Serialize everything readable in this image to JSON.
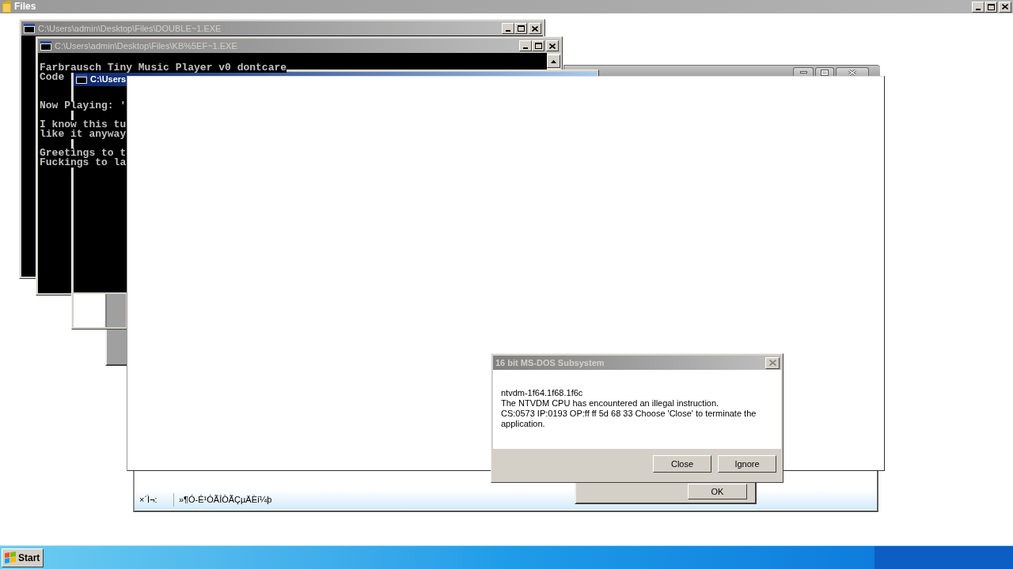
{
  "top_window": {
    "title": "Files"
  },
  "console_windows": [
    {
      "title": "C:\\Users\\admin\\Desktop\\Files\\DOUBLE~1.EXE",
      "active": false
    },
    {
      "title": "C:\\Users\\admin\\Desktop\\Files\\KB%5EF~1.EXE",
      "active": false,
      "output": [
        [
          "Farbrausch Tiny Music Player v0 dontcare",
          "Code"
        ],
        [
          "Now Playing: '"
        ],
        [
          "I know this tu",
          "like it anyway"
        ],
        [
          "Greetings to t",
          "Fuckings to la"
        ]
      ]
    },
    {
      "title": "C:\\Users",
      "active": true
    }
  ],
  "status_window": {
    "status_label": "×´Ì¬:",
    "status_text": "»¶Ó-Ê¹ÓÃÎÒÃÇµÄÈí¼þ"
  },
  "message_window": {
    "button": "OK"
  },
  "dialog": {
    "title": "16 bit MS-DOS Subsystem",
    "active": false,
    "message": [
      "ntvdm-1f64.1f68.1f6c",
      "The NTVDM CPU has encountered an illegal instruction.",
      "CS:0573 IP:0193 OP:ff ff 5d 68 33 Choose 'Close' to terminate the application."
    ],
    "buttons": [
      "Close",
      "Ignore"
    ]
  },
  "taskbar": {
    "start_label": "Start"
  }
}
